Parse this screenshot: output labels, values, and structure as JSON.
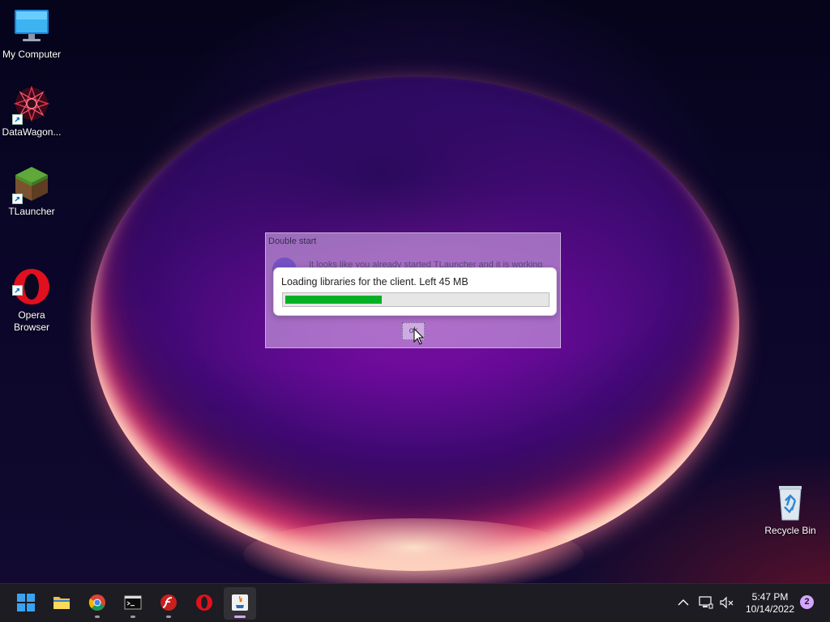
{
  "desktop": {
    "icons": [
      {
        "label": "My Computer",
        "icon": "monitor-icon"
      },
      {
        "label": "DataWagon...",
        "icon": "datawagon-icon"
      },
      {
        "label": "TLauncher",
        "icon": "grass-block-icon"
      },
      {
        "label": "Opera\nBrowser",
        "icon": "opera-icon"
      },
      {
        "label": "Recycle Bin",
        "icon": "recycle-bin-icon"
      }
    ]
  },
  "double_start_dialog": {
    "title": "Double start",
    "message": "It looks like you already started TLauncher and it is working",
    "ok_label": "ok"
  },
  "loading_dialog": {
    "message": "Loading libraries for the client. Left 45 MB",
    "progress_fraction": 0.37,
    "progress_color": "#06b025"
  },
  "taskbar": {
    "apps": [
      {
        "name": "start",
        "icon": "windows-start-icon"
      },
      {
        "name": "file-explorer",
        "icon": "folder-icon"
      },
      {
        "name": "chrome",
        "icon": "chrome-icon"
      },
      {
        "name": "terminal",
        "icon": "terminal-icon"
      },
      {
        "name": "flash",
        "icon": "flash-icon"
      },
      {
        "name": "opera",
        "icon": "opera-icon"
      },
      {
        "name": "java",
        "icon": "java-icon"
      }
    ],
    "tray": {
      "time": "5:47 PM",
      "date": "10/14/2022",
      "notification_count": "2"
    }
  },
  "colors": {
    "accent": "#d5a6ff",
    "taskbar_bg": "#1c1c22"
  }
}
